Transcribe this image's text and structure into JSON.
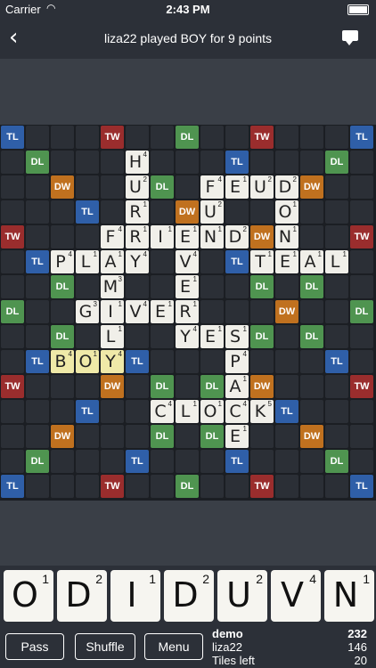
{
  "status": {
    "carrier": "Carrier",
    "time": "2:43 PM"
  },
  "nav": {
    "title": "liza22 played BOY for 9 points"
  },
  "board": {
    "bonuses": [
      {
        "r": 0,
        "c": 0,
        "t": "TL"
      },
      {
        "r": 0,
        "c": 4,
        "t": "TW"
      },
      {
        "r": 0,
        "c": 7,
        "t": "DL"
      },
      {
        "r": 0,
        "c": 10,
        "t": "TW"
      },
      {
        "r": 0,
        "c": 14,
        "t": "TL"
      },
      {
        "r": 1,
        "c": 1,
        "t": "DL"
      },
      {
        "r": 1,
        "c": 9,
        "t": "TL"
      },
      {
        "r": 1,
        "c": 13,
        "t": "DL"
      },
      {
        "r": 2,
        "c": 2,
        "t": "DW"
      },
      {
        "r": 2,
        "c": 6,
        "t": "DL"
      },
      {
        "r": 2,
        "c": 12,
        "t": "DW"
      },
      {
        "r": 3,
        "c": 3,
        "t": "TL"
      },
      {
        "r": 3,
        "c": 7,
        "t": "DW"
      },
      {
        "r": 4,
        "c": 0,
        "t": "TW"
      },
      {
        "r": 4,
        "c": 10,
        "t": "DW"
      },
      {
        "r": 4,
        "c": 14,
        "t": "TW"
      },
      {
        "r": 5,
        "c": 1,
        "t": "TL"
      },
      {
        "r": 5,
        "c": 9,
        "t": "TL"
      },
      {
        "r": 6,
        "c": 2,
        "t": "DL"
      },
      {
        "r": 6,
        "c": 10,
        "t": "DL"
      },
      {
        "r": 6,
        "c": 12,
        "t": "DL"
      },
      {
        "r": 7,
        "c": 0,
        "t": "DL"
      },
      {
        "r": 7,
        "c": 11,
        "t": "DW"
      },
      {
        "r": 7,
        "c": 14,
        "t": "DL"
      },
      {
        "r": 8,
        "c": 2,
        "t": "DL"
      },
      {
        "r": 8,
        "c": 10,
        "t": "DL"
      },
      {
        "r": 8,
        "c": 12,
        "t": "DL"
      },
      {
        "r": 9,
        "c": 1,
        "t": "TL"
      },
      {
        "r": 9,
        "c": 5,
        "t": "TL"
      },
      {
        "r": 9,
        "c": 13,
        "t": "TL"
      },
      {
        "r": 10,
        "c": 0,
        "t": "TW"
      },
      {
        "r": 10,
        "c": 4,
        "t": "DW"
      },
      {
        "r": 10,
        "c": 6,
        "t": "DL"
      },
      {
        "r": 10,
        "c": 8,
        "t": "DL"
      },
      {
        "r": 10,
        "c": 10,
        "t": "DW"
      },
      {
        "r": 10,
        "c": 14,
        "t": "TW"
      },
      {
        "r": 11,
        "c": 3,
        "t": "TL"
      },
      {
        "r": 11,
        "c": 11,
        "t": "TL"
      },
      {
        "r": 12,
        "c": 2,
        "t": "DW"
      },
      {
        "r": 12,
        "c": 6,
        "t": "DL"
      },
      {
        "r": 12,
        "c": 8,
        "t": "DL"
      },
      {
        "r": 12,
        "c": 12,
        "t": "DW"
      },
      {
        "r": 13,
        "c": 1,
        "t": "DL"
      },
      {
        "r": 13,
        "c": 5,
        "t": "TL"
      },
      {
        "r": 13,
        "c": 9,
        "t": "TL"
      },
      {
        "r": 13,
        "c": 13,
        "t": "DL"
      },
      {
        "r": 14,
        "c": 0,
        "t": "TL"
      },
      {
        "r": 14,
        "c": 4,
        "t": "TW"
      },
      {
        "r": 14,
        "c": 7,
        "t": "DL"
      },
      {
        "r": 14,
        "c": 10,
        "t": "TW"
      },
      {
        "r": 14,
        "c": 14,
        "t": "TL"
      }
    ],
    "tiles": [
      {
        "r": 1,
        "c": 5,
        "l": "H",
        "p": "4"
      },
      {
        "r": 2,
        "c": 5,
        "l": "U",
        "p": "2"
      },
      {
        "r": 2,
        "c": 8,
        "l": "F",
        "p": "4"
      },
      {
        "r": 2,
        "c": 9,
        "l": "E",
        "p": "1"
      },
      {
        "r": 2,
        "c": 10,
        "l": "U",
        "p": "2"
      },
      {
        "r": 2,
        "c": 11,
        "l": "D",
        "p": "2"
      },
      {
        "r": 3,
        "c": 5,
        "l": "R",
        "p": "1"
      },
      {
        "r": 3,
        "c": 8,
        "l": "U",
        "p": "2"
      },
      {
        "r": 3,
        "c": 11,
        "l": "O",
        "p": "1"
      },
      {
        "r": 4,
        "c": 4,
        "l": "F",
        "p": "4"
      },
      {
        "r": 4,
        "c": 5,
        "l": "R",
        "p": "1"
      },
      {
        "r": 4,
        "c": 6,
        "l": "I",
        "p": "1"
      },
      {
        "r": 4,
        "c": 7,
        "l": "E",
        "p": "1"
      },
      {
        "r": 4,
        "c": 8,
        "l": "N",
        "p": "1"
      },
      {
        "r": 4,
        "c": 9,
        "l": "D",
        "p": "2"
      },
      {
        "r": 4,
        "c": 11,
        "l": "N",
        "p": "1"
      },
      {
        "r": 5,
        "c": 2,
        "l": "P",
        "p": "4"
      },
      {
        "r": 5,
        "c": 3,
        "l": "L",
        "p": "1"
      },
      {
        "r": 5,
        "c": 4,
        "l": "A",
        "p": "1"
      },
      {
        "r": 5,
        "c": 5,
        "l": "Y",
        "p": "4"
      },
      {
        "r": 5,
        "c": 7,
        "l": "V",
        "p": "4"
      },
      {
        "r": 5,
        "c": 10,
        "l": "T",
        "p": "1"
      },
      {
        "r": 5,
        "c": 11,
        "l": "E",
        "p": "1"
      },
      {
        "r": 5,
        "c": 12,
        "l": "A",
        "p": "1"
      },
      {
        "r": 5,
        "c": 13,
        "l": "L",
        "p": "1"
      },
      {
        "r": 6,
        "c": 4,
        "l": "M",
        "p": "3"
      },
      {
        "r": 6,
        "c": 7,
        "l": "E",
        "p": "1"
      },
      {
        "r": 7,
        "c": 3,
        "l": "G",
        "p": "3"
      },
      {
        "r": 7,
        "c": 4,
        "l": "I",
        "p": "1"
      },
      {
        "r": 7,
        "c": 5,
        "l": "V",
        "p": "4"
      },
      {
        "r": 7,
        "c": 6,
        "l": "E",
        "p": "1"
      },
      {
        "r": 7,
        "c": 7,
        "l": "R",
        "p": "1"
      },
      {
        "r": 8,
        "c": 4,
        "l": "L",
        "p": "1"
      },
      {
        "r": 8,
        "c": 7,
        "l": "Y",
        "p": "4"
      },
      {
        "r": 8,
        "c": 8,
        "l": "E",
        "p": "1"
      },
      {
        "r": 8,
        "c": 9,
        "l": "S",
        "p": "1"
      },
      {
        "r": 9,
        "c": 2,
        "l": "B",
        "p": "4",
        "h": true
      },
      {
        "r": 9,
        "c": 3,
        "l": "O",
        "p": "1",
        "h": true
      },
      {
        "r": 9,
        "c": 4,
        "l": "Y",
        "p": "4",
        "h": true
      },
      {
        "r": 9,
        "c": 9,
        "l": "P",
        "p": "4"
      },
      {
        "r": 10,
        "c": 9,
        "l": "A",
        "p": "1"
      },
      {
        "r": 11,
        "c": 6,
        "l": "C",
        "p": "4"
      },
      {
        "r": 11,
        "c": 7,
        "l": "L",
        "p": "1"
      },
      {
        "r": 11,
        "c": 8,
        "l": "O",
        "p": "1"
      },
      {
        "r": 11,
        "c": 9,
        "l": "C",
        "p": "4"
      },
      {
        "r": 11,
        "c": 10,
        "l": "K",
        "p": "5"
      },
      {
        "r": 12,
        "c": 9,
        "l": "E",
        "p": "1"
      }
    ]
  },
  "rack": [
    {
      "l": "O",
      "p": "1"
    },
    {
      "l": "D",
      "p": "2"
    },
    {
      "l": "I",
      "p": "1"
    },
    {
      "l": "D",
      "p": "2"
    },
    {
      "l": "U",
      "p": "2"
    },
    {
      "l": "V",
      "p": "4"
    },
    {
      "l": "N",
      "p": "1"
    }
  ],
  "buttons": {
    "pass": "Pass",
    "shuffle": "Shuffle",
    "menu": "Menu"
  },
  "scores": {
    "p1_name": "demo",
    "p1_score": "232",
    "p2_name": "liza22",
    "p2_score": "146",
    "tiles_label": "Tiles left",
    "tiles_left": "20"
  }
}
